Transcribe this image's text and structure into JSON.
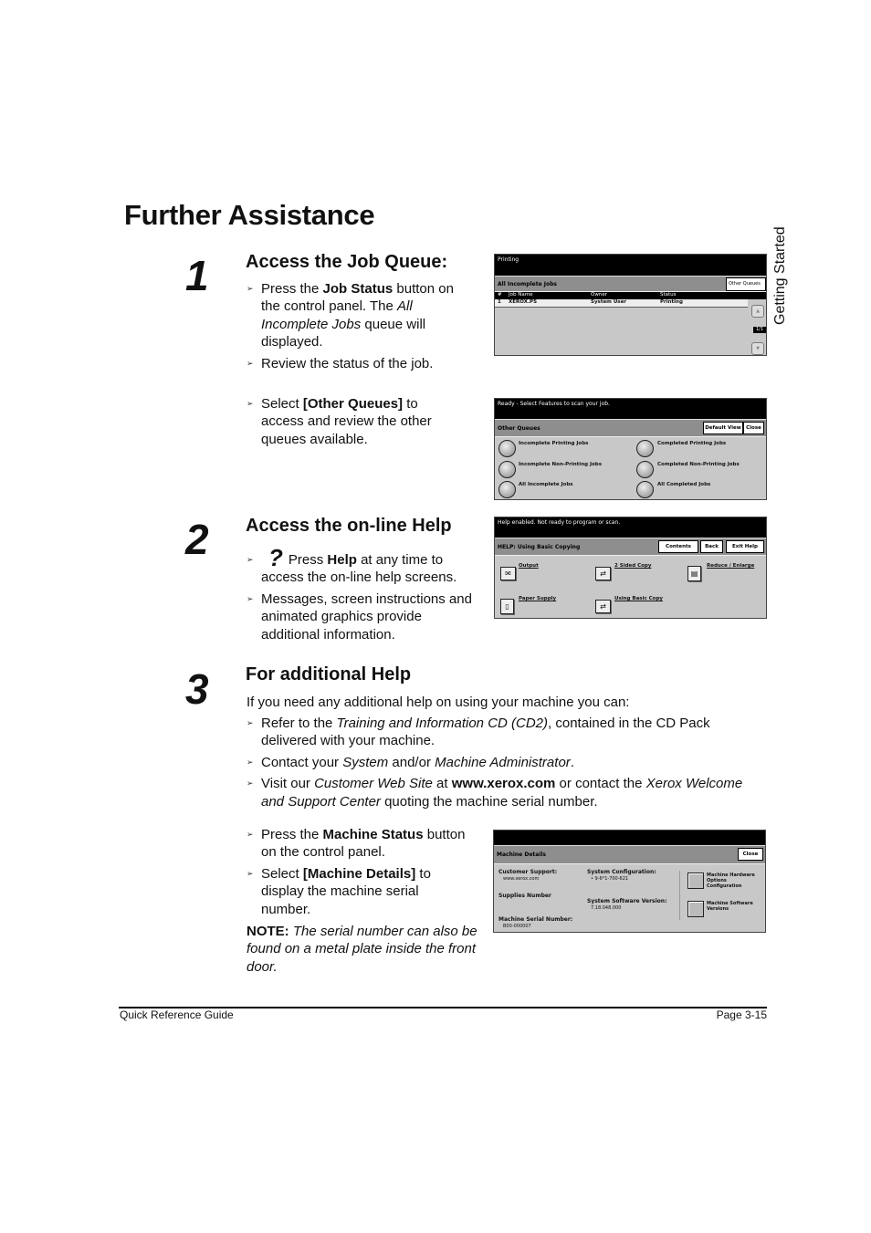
{
  "page_title": "Further Assistance",
  "side_tab": "Getting Started",
  "steps": [
    {
      "number": "1",
      "heading": "Access the Job Queue:",
      "bullets": [
        {
          "parts": [
            "Press the ",
            "Job Status",
            " button on the control panel. The ",
            "All Incomplete Jobs",
            " queue will displayed."
          ]
        },
        {
          "text": "Review the status of the job."
        },
        {
          "parts": [
            "Select ",
            "[Other Queues]",
            " to access and review the other queues available."
          ]
        }
      ]
    },
    {
      "number": "2",
      "heading": "Access the on-line Help",
      "bullets": [
        {
          "icon": "help-question-icon",
          "icon_glyph": "?",
          "parts": [
            "Press ",
            "Help",
            " at any time to access the on-line help screens."
          ]
        },
        {
          "text": "Messages, screen instructions and animated graphics provide additional information."
        }
      ]
    },
    {
      "number": "3",
      "heading": "For additional Help",
      "intro": "If you need any additional help on using your machine you can:",
      "bullets": [
        {
          "parts": [
            "Refer to the ",
            "Training and Information CD (CD2)",
            ", contained in the CD Pack delivered with your machine."
          ]
        },
        {
          "parts": [
            "Contact your ",
            "System",
            " and/or ",
            "Machine Administrator",
            "."
          ]
        },
        {
          "parts": [
            "Visit our ",
            "Customer Web Site",
            " at ",
            "www.xerox.com",
            " or contact the ",
            "Xerox Welcome and Support Center",
            " quoting the machine serial number."
          ]
        },
        {
          "parts": [
            "Press the ",
            "Machine Status",
            " button on the control panel."
          ]
        },
        {
          "parts": [
            "Select ",
            "[Machine Details]",
            " to display the machine serial number."
          ]
        }
      ],
      "note_label": "NOTE:",
      "note_text": "The serial number can also be found on a metal plate inside the front door."
    }
  ],
  "screens": {
    "job_queue": {
      "header": "Printing",
      "bar_title": "All Incomplete Jobs",
      "other_queues_button": "Other Queues",
      "columns": [
        "#",
        "Job Name",
        "Owner",
        "Status"
      ],
      "rows": [
        [
          "1",
          "XEROX.PS",
          "System User",
          "Printing"
        ]
      ],
      "page_indicator": "1/1",
      "scroll_up_icon": "▲",
      "scroll_down_icon": "▼"
    },
    "other_queues": {
      "header": "Ready -  Select Features to scan your job.",
      "bar_title": "Other Queues",
      "default_view_button": "Default View",
      "close_button": "Close",
      "options": [
        "Incomplete Printing Jobs",
        "Completed Printing Jobs",
        "Incomplete Non-Printing Jobs",
        "Completed Non-Printing Jobs",
        "All Incomplete Jobs",
        "All Completed Jobs"
      ]
    },
    "help": {
      "header": "Help enabled.  Not ready to program or scan.",
      "bar_title": "HELP:  Using Basic Copying",
      "contents_button": "Contents",
      "back_button": "Back",
      "exit_help_button": "Exit Help",
      "topics": [
        "Output",
        "2 Sided Copy",
        "Reduce / Enlarge",
        "Paper Supply",
        "Using Basic Copy"
      ]
    },
    "machine_details": {
      "header": "",
      "bar_title": "Machine Details",
      "close_button": "Close",
      "customer_support_label": "Customer Support:",
      "customer_support_value": "www.xerox.com",
      "supplies_label": "Supplies Number",
      "serial_label": "Machine Serial Number:",
      "serial_value": "B00-000007",
      "sys_config_label": "System Configuration:",
      "sys_config_value": "• 9-6*1-700-621",
      "sw_version_label": "System Software Version:",
      "sw_version_value": "7.18.048.000",
      "hw_options_button": "Machine Hardware Options Configuration",
      "sw_versions_button": "Machine Software Versions"
    }
  },
  "footer": {
    "left": "Quick Reference Guide",
    "right": "Page 3-15"
  }
}
